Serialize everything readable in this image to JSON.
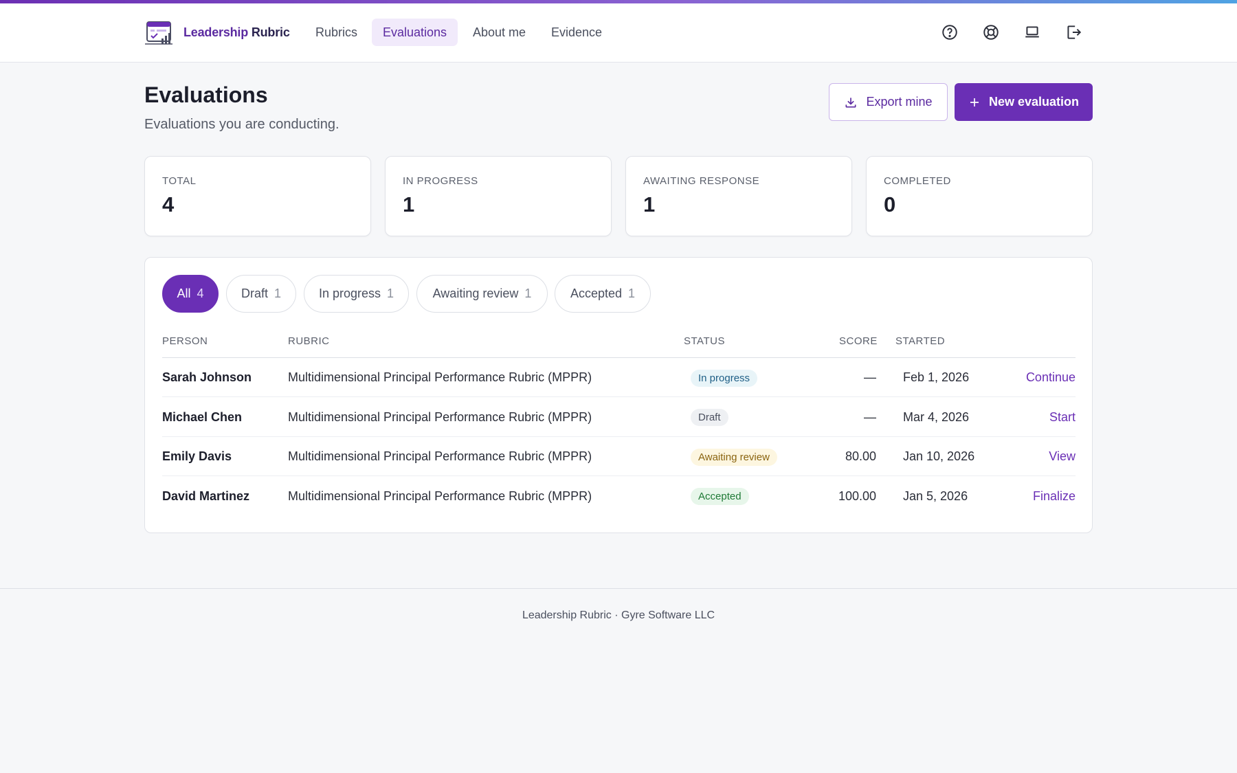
{
  "app": {
    "brand_part1": "Leadership",
    "brand_part2": " Rubric"
  },
  "nav": {
    "items": [
      {
        "label": "Rubrics"
      },
      {
        "label": "Evaluations",
        "active": true
      },
      {
        "label": "About me"
      },
      {
        "label": "Evidence"
      }
    ],
    "icons": [
      "help-circle-icon",
      "lifebuoy-icon",
      "laptop-icon",
      "logout-icon"
    ]
  },
  "page": {
    "title": "Evaluations",
    "subtitle": "Evaluations you are conducting."
  },
  "actions": {
    "export_label": "Export mine",
    "new_label": "New evaluation"
  },
  "stats": [
    {
      "label": "TOTAL",
      "value": "4"
    },
    {
      "label": "IN PROGRESS",
      "value": "1"
    },
    {
      "label": "AWAITING RESPONSE",
      "value": "1"
    },
    {
      "label": "COMPLETED",
      "value": "0"
    }
  ],
  "filters": [
    {
      "label": "All",
      "count": "4",
      "active": true
    },
    {
      "label": "Draft",
      "count": "1"
    },
    {
      "label": "In progress",
      "count": "1"
    },
    {
      "label": "Awaiting review",
      "count": "1"
    },
    {
      "label": "Accepted",
      "count": "1"
    }
  ],
  "table": {
    "headers": {
      "person": "PERSON",
      "rubric": "RUBRIC",
      "status": "STATUS",
      "score": "SCORE",
      "started": "STARTED"
    },
    "rows": [
      {
        "person": "Sarah Johnson",
        "rubric": "Multidimensional Principal Performance Rubric (MPPR)",
        "status": "In progress",
        "score": "—",
        "started": "Feb 1, 2026",
        "action": "Continue"
      },
      {
        "person": "Michael Chen",
        "rubric": "Multidimensional Principal Performance Rubric (MPPR)",
        "status": "Draft",
        "score": "—",
        "started": "Mar 4, 2026",
        "action": "Start"
      },
      {
        "person": "Emily Davis",
        "rubric": "Multidimensional Principal Performance Rubric (MPPR)",
        "status": "Awaiting review",
        "score": "80.00",
        "started": "Jan 10, 2026",
        "action": "View"
      },
      {
        "person": "David Martinez",
        "rubric": "Multidimensional Principal Performance Rubric (MPPR)",
        "status": "Accepted",
        "score": "100.00",
        "started": "Jan 5, 2026",
        "action": "Finalize"
      }
    ]
  },
  "status_colors": {
    "In progress": {
      "bg": "#e8f4f8",
      "fg": "#1f5f86"
    },
    "Draft": {
      "bg": "#eef0f3",
      "fg": "#4a4f5e"
    },
    "Awaiting review": {
      "bg": "#fdf6e0",
      "fg": "#8a6410"
    },
    "Accepted": {
      "bg": "#e7f6ea",
      "fg": "#1f7a36"
    }
  },
  "theme": {
    "accent": "#6a2fb5"
  },
  "footer": {
    "text": "Leadership Rubric · Gyre Software LLC"
  }
}
